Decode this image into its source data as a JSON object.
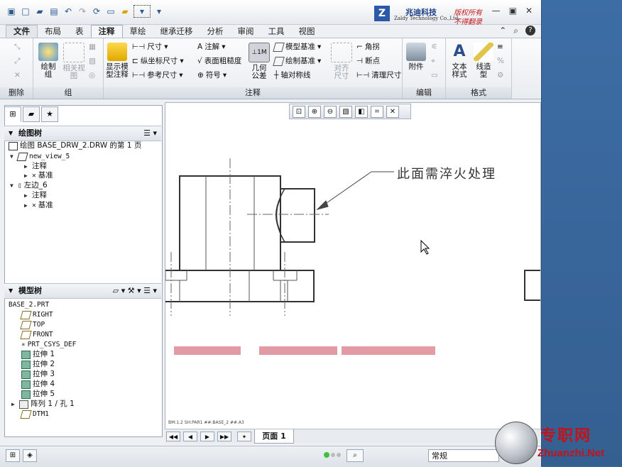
{
  "titlebar": {
    "logo_cn": "兆迪科技",
    "logo_en": "Zaldy Technology Co.,Ltd.",
    "copyright_1": "版权所有",
    "copyright_2": "不得翻录"
  },
  "tabs": [
    "文件",
    "布局",
    "表",
    "注释",
    "草绘",
    "继承迁移",
    "分析",
    "审阅",
    "工具",
    "视图"
  ],
  "active_tab": "注释",
  "ribbon": {
    "groups": {
      "delete": "删除",
      "group": "组",
      "annotation": "注释",
      "edit": "编辑",
      "format": "格式"
    },
    "draw_group": "绘制\n组",
    "related_view": "相关视\n图",
    "show_model_annotation": "显示模\n型注释",
    "dimension": "尺寸",
    "ordinate_dimension": "纵坐标尺寸",
    "reference_dimension": "参考尺寸",
    "note": "注解",
    "surface_finish": "表面粗糙度",
    "symbol": "符号",
    "geometric_tolerance": "几何\n公差",
    "model_datum": "模型基准",
    "draw_datum": "绘制基准",
    "axis_symmetric": "轴对称线",
    "align_dimension": "对齐\n尺寸",
    "jog": "角拐",
    "breakpoint": "断点",
    "cleanup_dimension": "清理尺寸",
    "attach": "附件",
    "text_style": "文本\n样式",
    "line_style": "线造\n型"
  },
  "drawing_tree": {
    "title": "绘图树",
    "root": "绘图 BASE_DRW_2.DRW 的第 1 页",
    "items": [
      "new_view_5",
      "注释",
      "基准",
      "左边_6",
      "注释",
      "基准"
    ]
  },
  "model_tree": {
    "title": "模型树",
    "root": "BASE_2.PRT",
    "items": [
      "RIGHT",
      "TOP",
      "FRONT",
      "PRT_CSYS_DEF",
      "拉伸 1",
      "拉伸 2",
      "拉伸 3",
      "拉伸 4",
      "拉伸 5",
      "阵列 1 / 孔 1",
      "DTM1"
    ]
  },
  "canvas": {
    "annotation": "此面需淬火处理",
    "footer": "BM:1.2     SH:PAR1  ##:BASE_2  ##.A3"
  },
  "page": {
    "tab": "页面 1"
  },
  "status": {
    "mode": "常规"
  },
  "watermark": {
    "name": "专职网",
    "url": "Zhuanzhi.Net"
  }
}
